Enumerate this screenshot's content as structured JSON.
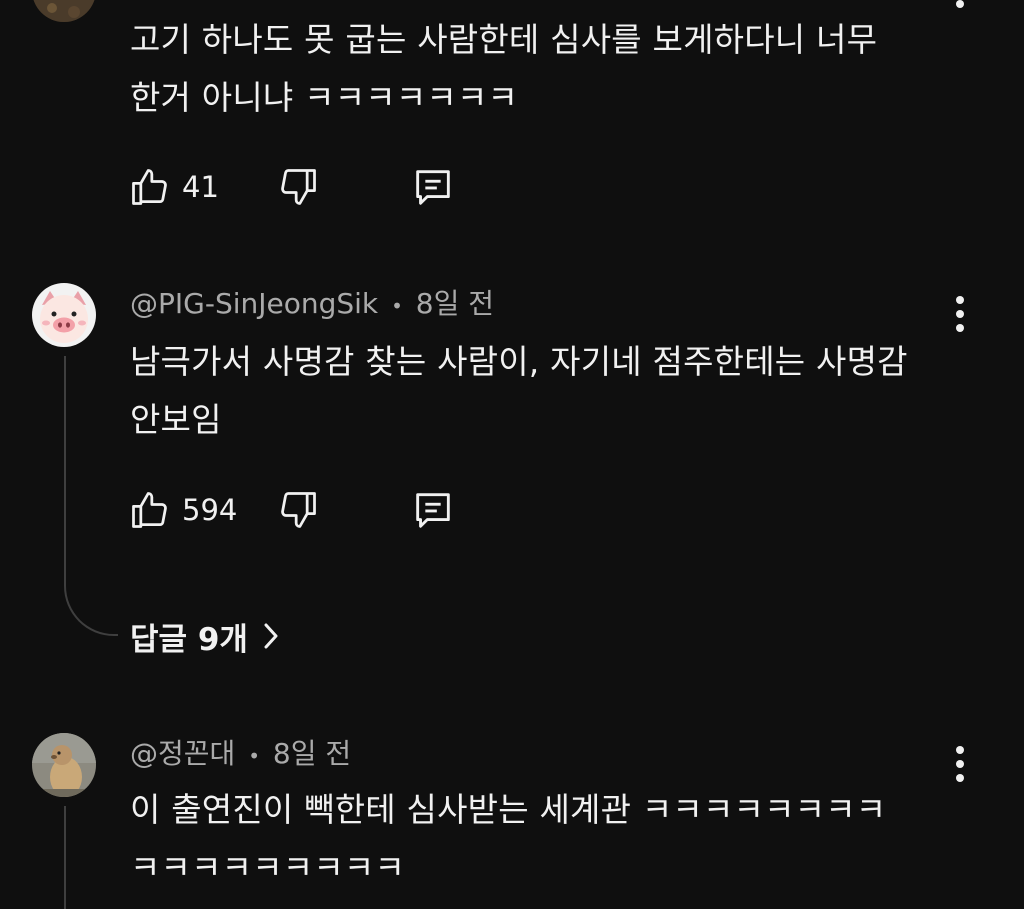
{
  "comments": [
    {
      "avatar": "dark-texture-avatar",
      "text_lines": [
        "고기 하나도 못 굽는 사람한테 심사를 보게하다니 너무",
        "한거 아니냐 ㅋㅋㅋㅋㅋㅋㅋ"
      ],
      "likes": "41"
    },
    {
      "author": "@PIG-SinJeongSik",
      "time": "8일 전",
      "avatar": "pig-avatar",
      "text_lines": [
        "남극가서 사명감 찾는 사람이, 자기네 점주한테는 사명감",
        "안보임"
      ],
      "likes": "594",
      "replies_label": "답글 9개"
    },
    {
      "author": "@정꼰대",
      "time": "8일 전",
      "avatar": "marmot-avatar",
      "text_lines": [
        "이 출연진이 빽한테 심사받는 세계관 ㅋㅋㅋㅋㅋㅋㅋㅋ",
        "ㅋㅋㅋㅋㅋㅋㅋㅋㅋ"
      ]
    }
  ],
  "separator": "•",
  "icons": {
    "like": "thumbs-up-icon",
    "dislike": "thumbs-down-icon",
    "reply": "comment-icon",
    "more": "more-vert-icon",
    "chevron": "chevron-right-icon"
  },
  "colors": {
    "background": "#0f0f0f",
    "text": "#f1f1f1",
    "meta": "#aaaaaa",
    "thread": "#3f3f3f"
  }
}
